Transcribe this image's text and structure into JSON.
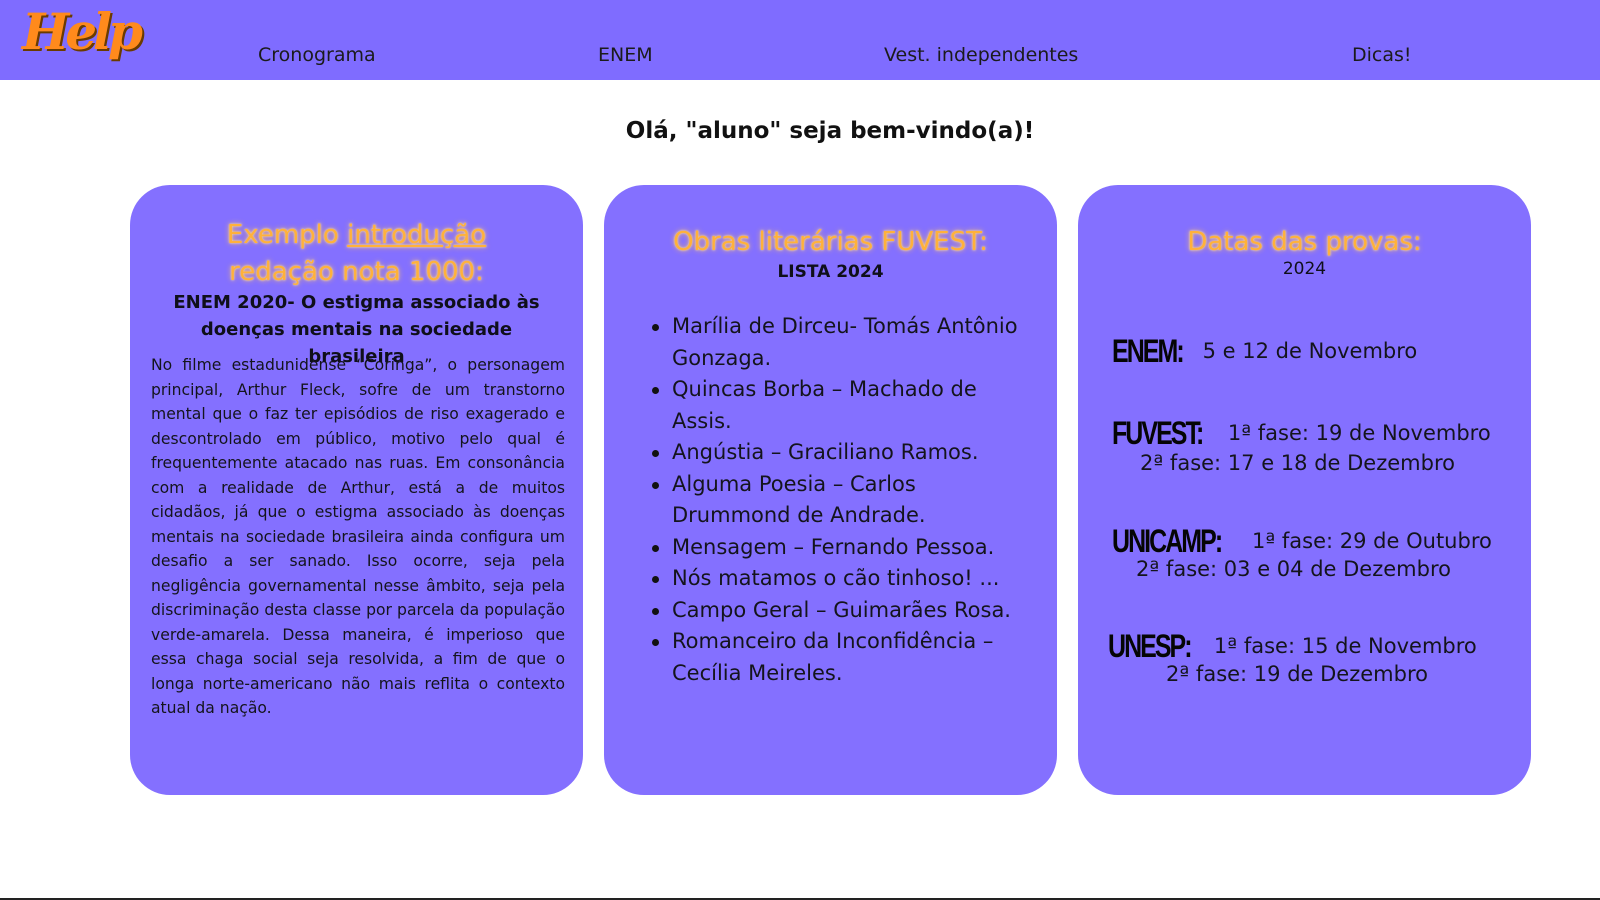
{
  "navbar": {
    "logo_text": "Help",
    "items": [
      {
        "label": "Cronograma"
      },
      {
        "label": "ENEM"
      },
      {
        "label": "Vest. independentes"
      },
      {
        "label": "Dicas!"
      }
    ],
    "background": "#7f6cff"
  },
  "welcome": "Olá, \"aluno\" seja bem-vindo(a)!",
  "card1": {
    "title_prefix": "Exemplo ",
    "title_link": "introdução",
    "title_line2": "redação nota 1000:",
    "subtitle": "ENEM 2020-  O estigma associado às doenças mentais na sociedade brasileira",
    "essay": "No filme estadunidense “Coringa”, o personagem principal, Arthur Fleck, sofre de um transtorno mental que o faz ter episódios de riso exagerado e descontrolado em público, motivo pelo qual é frequentemente atacado nas ruas. Em consonância com a realidade de Arthur, está a de muitos cidadãos, já que o estigma associado às doenças mentais na sociedade brasileira ainda configura um desafio a ser sanado. Isso ocorre, seja pela negligência governamental nesse âmbito, seja pela discriminação desta classe por parcela da população verde-amarela. Dessa maneira, é imperioso que essa chaga social seja resolvida, a fim de que o longa norte-americano não mais reflita o contexto atual da nação."
  },
  "card2": {
    "title": "Obras literárias FUVEST:",
    "subtitle": "LISTA 2024",
    "works": [
      "Marília de Dirceu- Tomás Antônio Gonzaga.",
      "Quincas Borba – Machado de Assis.",
      "Angústia – Graciliano Ramos.",
      "Alguma Poesia – Carlos Drummond de Andrade.",
      "Mensagem – Fernando Pessoa.",
      "Nós matamos o cão tinhoso! ...",
      "Campo Geral – Guimarães Rosa.",
      "Romanceiro da Inconfidência – Cecília Meireles."
    ]
  },
  "card3": {
    "title": "Datas das provas:",
    "subtitle": "2024",
    "exams": [
      {
        "label": "ENEM:",
        "line1": "5 e 12 de Novembro",
        "line2": ""
      },
      {
        "label": "FUVEST:",
        "line1": "1ª fase: 19 de Novembro",
        "line2": "2ª fase: 17 e 18 de Dezembro"
      },
      {
        "label": "UNICAMP:",
        "line1": "1ª fase: 29 de Outubro",
        "line2": "2ª fase: 03 e 04 de Dezembro"
      },
      {
        "label": "UNESP:",
        "line1": "1ª fase: 15 de Novembro",
        "line2": "2ª fase: 19 de Dezembro"
      }
    ]
  },
  "colors": {
    "card_background": "#8470ff",
    "title_glow": "#ffb13b",
    "logo": "#ff8a1c"
  }
}
